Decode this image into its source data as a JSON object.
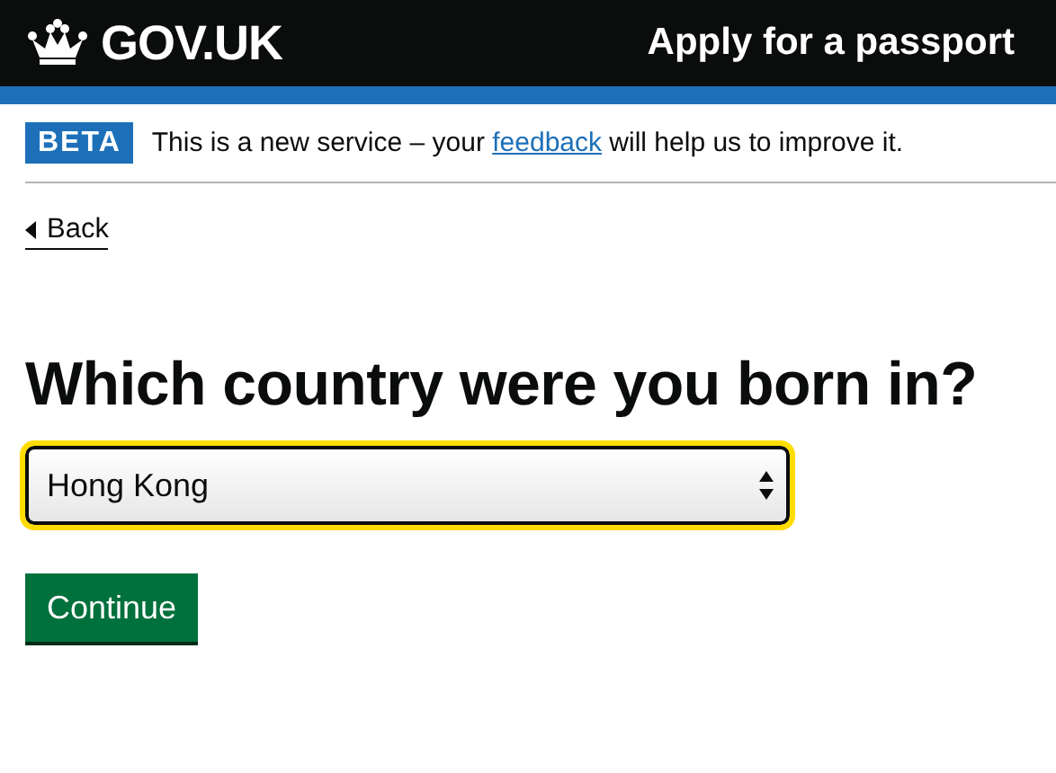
{
  "header": {
    "logo": "GOV.UK",
    "service": "Apply for a passport"
  },
  "phase_banner": {
    "tag": "BETA",
    "text_before": "This is a new service – your",
    "link": "feedback",
    "text_after": "will help us to improve it."
  },
  "back_link": "Back",
  "question": "Which country were you born in?",
  "country_select": {
    "value": "Hong Kong",
    "focused": true
  },
  "buttons": [
    "Continue"
  ]
}
